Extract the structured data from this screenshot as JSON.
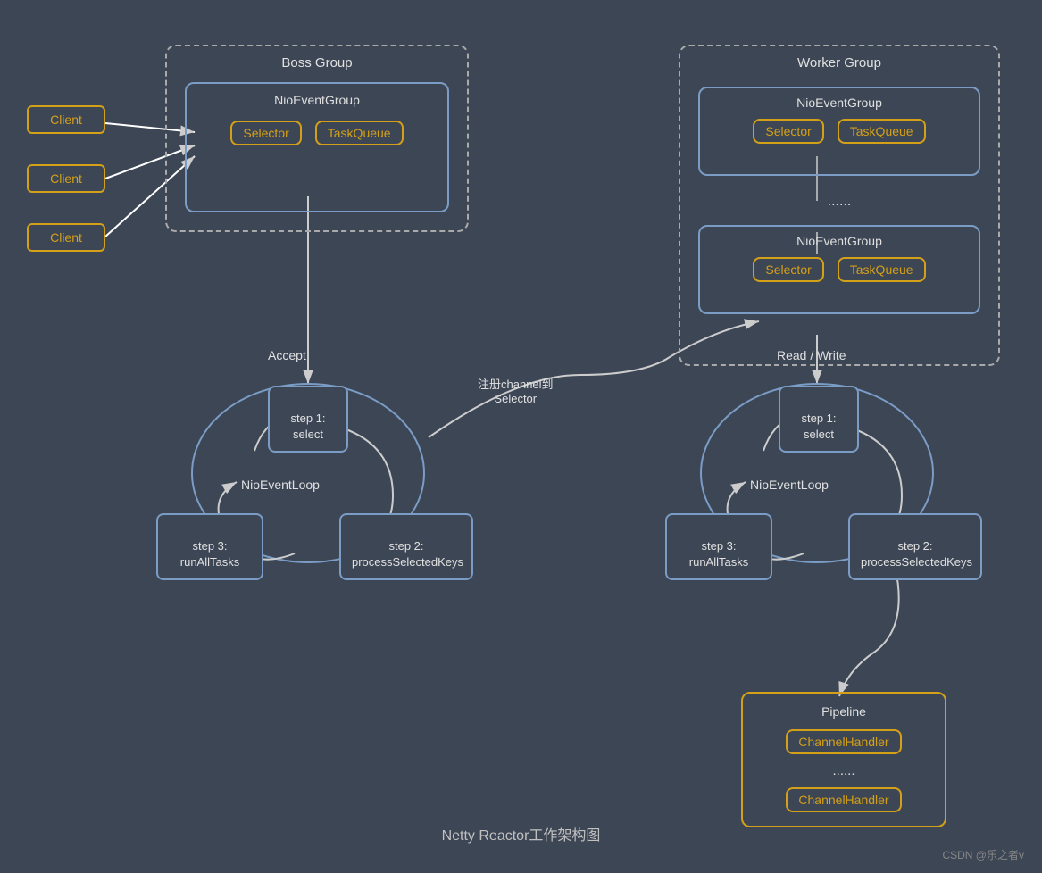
{
  "title": "Netty Reactor工作架构图",
  "csdn": "CSDN @乐之者v",
  "clients": [
    "Client",
    "Client",
    "Client"
  ],
  "bossGroup": {
    "title": "Boss Group",
    "nioEventGroup": "NioEventGroup",
    "selector": "Selector",
    "taskQueue": "TaskQueue"
  },
  "workerGroup": {
    "title": "Worker Group",
    "nioEventGroup": "NioEventGroup",
    "selector": "Selector",
    "taskQueue": "TaskQueue",
    "ellipsis": "......",
    "nioEventGroup2": "NioEventGroup",
    "selector2": "Selector",
    "taskQueue2": "TaskQueue"
  },
  "bossLoop": {
    "label": "NioEventLoop",
    "accept": "Accept",
    "step1": "step 1:\nselect",
    "step2": "step 2:\nprocessSelectedKeys",
    "step3": "step 3:\nrunAllTasks"
  },
  "workerLoop": {
    "label": "NioEventLoop",
    "readWrite": "Read / Write",
    "registerLabel": "注册channel到\nSelector",
    "step1": "step 1:\nselect",
    "step2": "step 2:\nprocessSelectedKeys",
    "step3": "step 3:\nrunAllTasks"
  },
  "pipeline": {
    "title": "Pipeline",
    "handler1": "ChannelHandler",
    "ellipsis": "......",
    "handler2": "ChannelHandler"
  }
}
